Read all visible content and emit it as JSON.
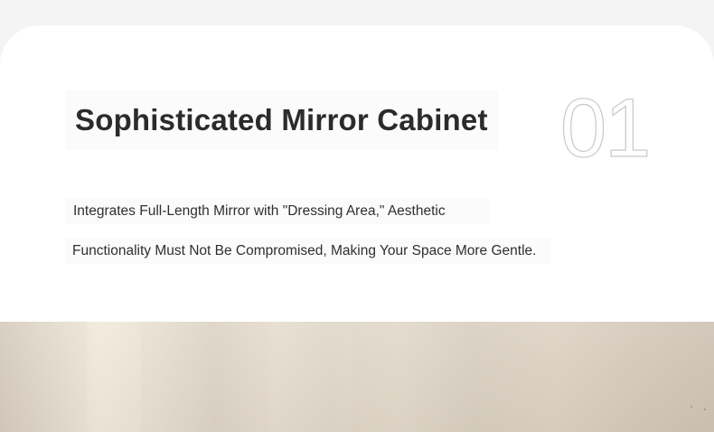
{
  "section": {
    "title": "Sophisticated Mirror Cabinet",
    "number": "01",
    "description_lines": [
      "Integrates Full-Length Mirror with \"Dressing Area,\" Aesthetic",
      "Functionality Must Not Be Compromised, Making Your Space More Gentle."
    ]
  },
  "colors": {
    "background": "#f4f4f4",
    "card": "#ffffff",
    "title_text": "#2b2b2b",
    "body_text": "#2f2f2f",
    "number_outline": "#c9c9c9",
    "photo_tone": "#e2d9ca"
  }
}
